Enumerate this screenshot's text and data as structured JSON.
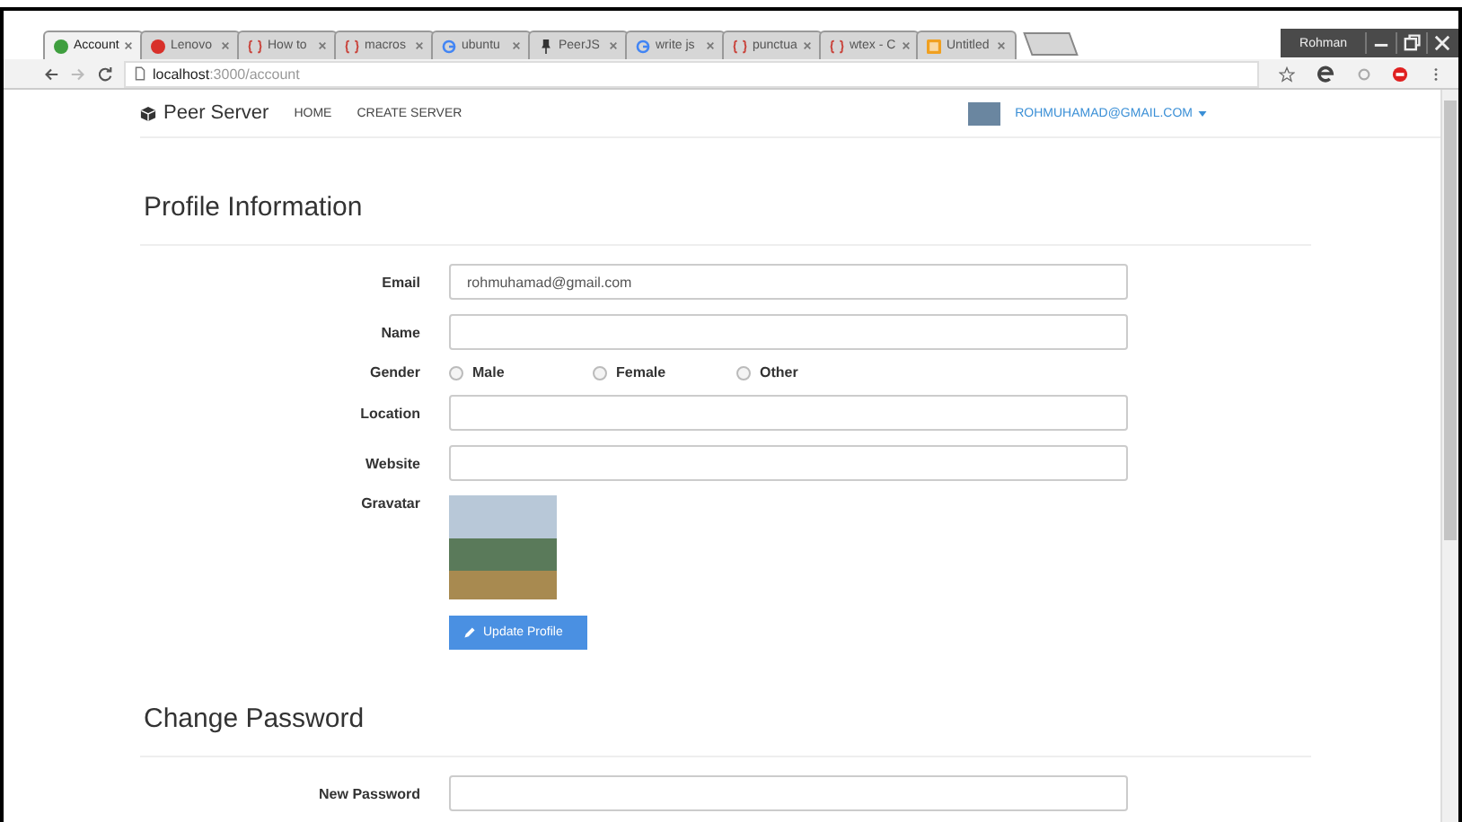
{
  "browser": {
    "tabs": [
      {
        "title": "Account",
        "kind": "dot",
        "color": "#3f9f3f",
        "selected": true
      },
      {
        "title": "Lenovo",
        "kind": "dot",
        "color": "#d8302a",
        "selected": false
      },
      {
        "title": "How to",
        "kind": "braces",
        "color": "#c9423a",
        "selected": false
      },
      {
        "title": "macros",
        "kind": "braces",
        "color": "#c9423a",
        "selected": false
      },
      {
        "title": "ubuntu",
        "kind": "g",
        "color": "#4285f4",
        "selected": false
      },
      {
        "title": "PeerJS",
        "kind": "pin",
        "color": "#333333",
        "selected": false
      },
      {
        "title": "write js",
        "kind": "g",
        "color": "#4285f4",
        "selected": false
      },
      {
        "title": "punctua",
        "kind": "braces",
        "color": "#c9423a",
        "selected": false
      },
      {
        "title": "wtex - C",
        "kind": "braces",
        "color": "#c9423a",
        "selected": false
      },
      {
        "title": "Untitled",
        "kind": "tile",
        "color": "#f0a020",
        "selected": false
      }
    ],
    "profile": "Rohman",
    "url_host": "localhost",
    "url_path": ":3000/account"
  },
  "navbar": {
    "brand": "Peer Server",
    "links": [
      "HOME",
      "CREATE SERVER"
    ],
    "user_email": "ROHMUHAMAD@GMAIL.COM"
  },
  "profile_section": {
    "heading": "Profile Information",
    "fields": [
      {
        "kind": "text",
        "label": "Email",
        "value": "rohmuhamad@gmail.com"
      },
      {
        "kind": "text",
        "label": "Name"
      },
      {
        "kind": "radio",
        "label": "Gender",
        "options": [
          {
            "label": "Male",
            "selected": false
          },
          {
            "label": "Female",
            "selected": false
          },
          {
            "label": "Other",
            "selected": false
          }
        ]
      },
      {
        "kind": "text",
        "label": "Location"
      },
      {
        "kind": "text",
        "label": "Website"
      },
      {
        "kind": "image",
        "label": "Gravatar"
      }
    ],
    "button": "Update Profile"
  },
  "password_section": {
    "heading": "Change Password",
    "fields": [
      {
        "kind": "text",
        "label": "New Password"
      }
    ]
  }
}
